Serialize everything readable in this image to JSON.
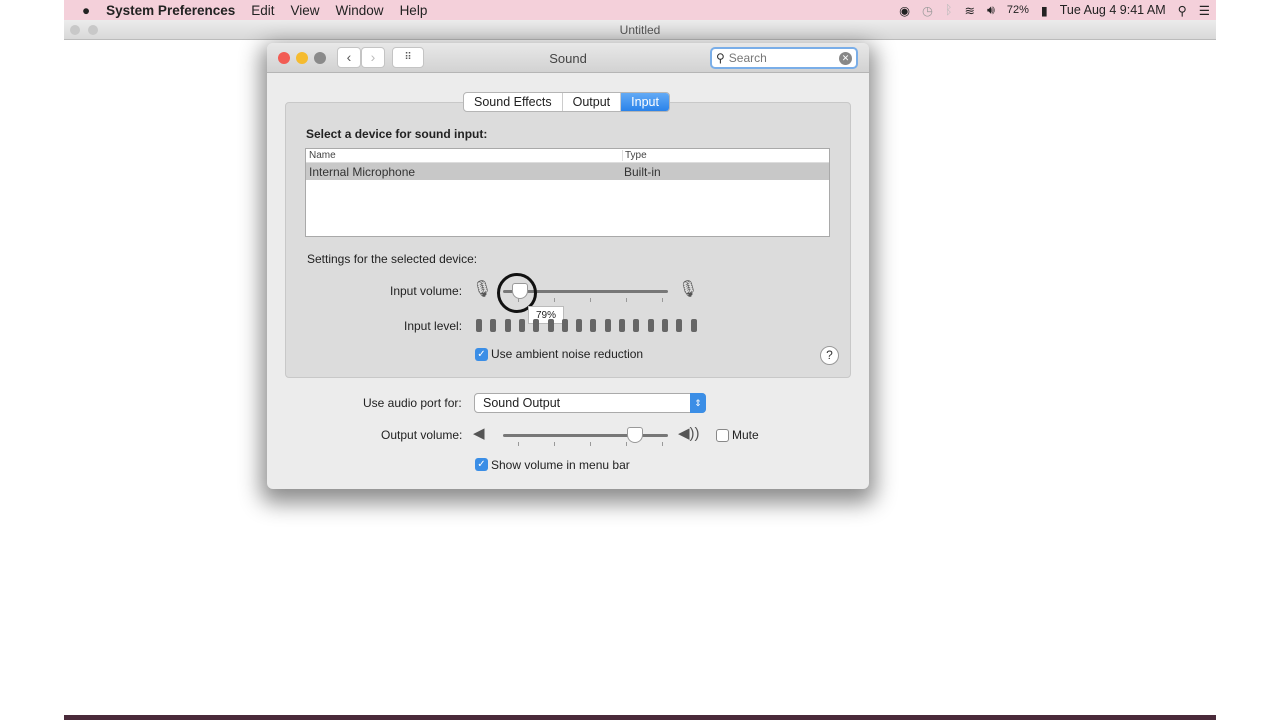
{
  "menubar": {
    "app": "System Preferences",
    "items": [
      "Edit",
      "View",
      "Window",
      "Help"
    ],
    "battery": "72%",
    "datetime": "Tue Aug 4  9:41 AM",
    "icons": [
      "apple-icon",
      "record-icon",
      "time-machine-icon",
      "bluetooth-icon",
      "wifi-icon",
      "volume-icon",
      "battery-icon",
      "spotlight-icon",
      "notification-center-icon"
    ],
    "background": "#f4d0da"
  },
  "bg_window": {
    "title": "Untitled"
  },
  "window": {
    "title": "Sound",
    "search_placeholder": "Search"
  },
  "tabs": [
    {
      "label": "Sound Effects",
      "active": false
    },
    {
      "label": "Output",
      "active": false
    },
    {
      "label": "Input",
      "active": true
    }
  ],
  "input": {
    "select_label": "Select a device for sound input:",
    "columns": [
      "Name",
      "Type"
    ],
    "rows": [
      {
        "name": "Internal Microphone",
        "type": "Built-in",
        "selected": true
      }
    ],
    "settings_label": "Settings for the selected device:",
    "input_volume_label": "Input volume:",
    "input_volume_fraction": 0.1,
    "tooltip": "79%",
    "input_level_label": "Input level:",
    "input_level_bars": 16,
    "noise_reduction_label": "Use ambient noise reduction",
    "noise_reduction_checked": true
  },
  "audio_port_label": "Use audio port for:",
  "audio_port_value": "Sound Output",
  "output_volume_label": "Output volume:",
  "output_volume_fraction": 0.8,
  "mute_label": "Mute",
  "mute_checked": false,
  "show_volume_label": "Show volume in menu bar",
  "show_volume_checked": true,
  "accent": "#3b8ee6"
}
